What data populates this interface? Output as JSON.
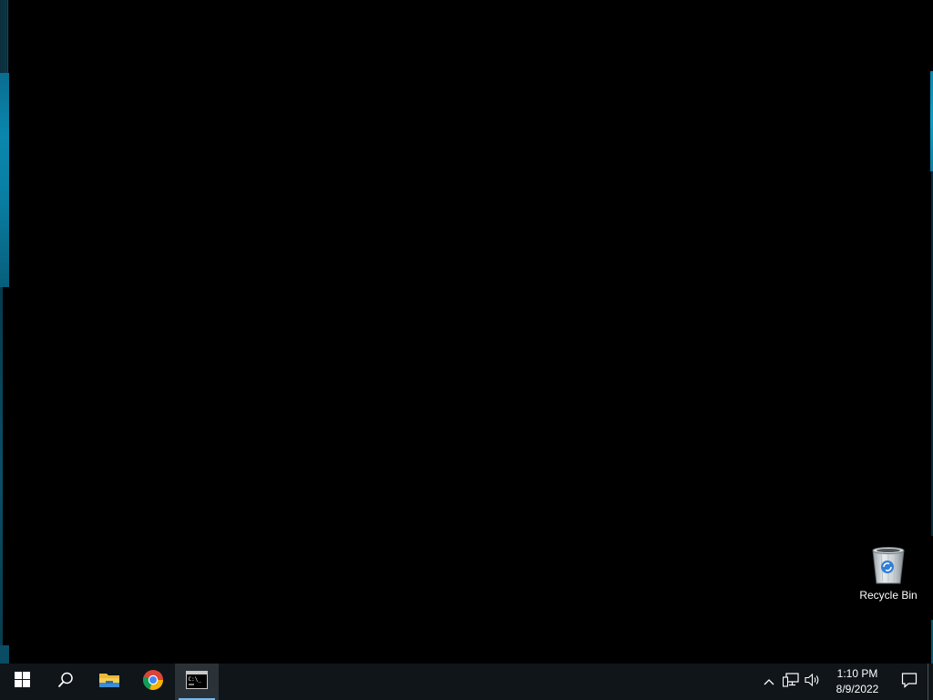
{
  "desktop": {
    "icons": [
      {
        "label": "Recycle Bin",
        "icon": "recycle-bin-icon"
      }
    ]
  },
  "taskbar": {
    "start": {
      "icon": "windows-logo-icon"
    },
    "search": {
      "icon": "search-icon"
    },
    "pinned": [
      {
        "name": "File Explorer",
        "icon": "folder-icon",
        "active": false
      },
      {
        "name": "Google Chrome",
        "icon": "chrome-icon",
        "active": false
      },
      {
        "name": "Command Prompt",
        "icon": "terminal-icon",
        "active": true
      }
    ],
    "tray": {
      "icons": [
        "chevron-up-icon",
        "network-icon",
        "volume-icon"
      ],
      "time": "1:10 PM",
      "date": "8/9/2022",
      "notification_icon": "notification-icon"
    }
  },
  "colors": {
    "taskbar_bg": "#0f1519",
    "accent": "#76b9ed",
    "wallpaper_teal": "#0a87ad"
  }
}
